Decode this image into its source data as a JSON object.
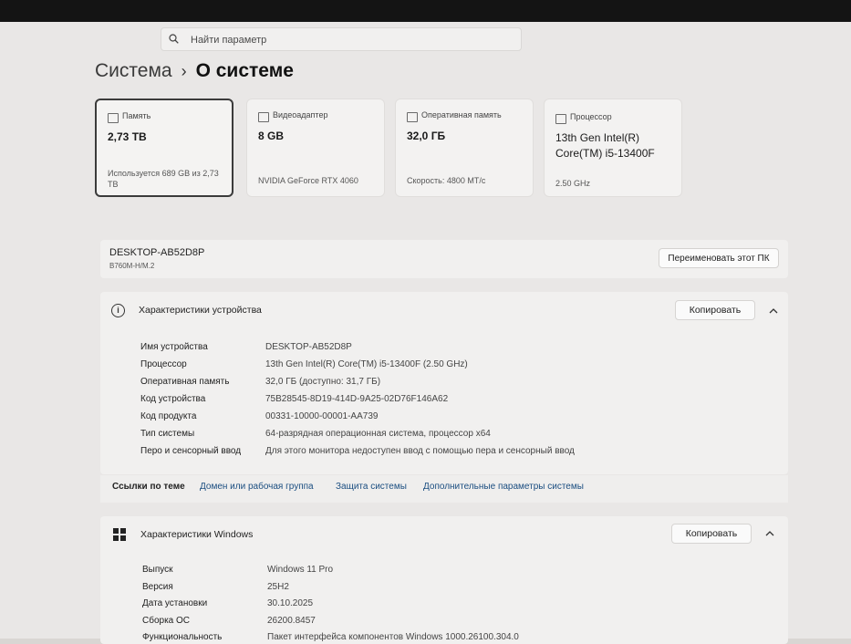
{
  "search": {
    "placeholder": "Найти параметр"
  },
  "breadcrumb": {
    "parent": "Система",
    "separator": "›",
    "current": "О системе"
  },
  "cards": [
    {
      "icon": "storage-icon",
      "label": "Память",
      "value": "2,73 TB",
      "detail": "Используется 689 GB из 2,73 TB"
    },
    {
      "icon": "gpu-icon",
      "label": "Видеоадаптер",
      "value": "8 GB",
      "detail": "NVIDIA GeForce RTX 4060"
    },
    {
      "icon": "ram-icon",
      "label": "Оперативная память",
      "value": "32,0 ГБ",
      "detail": "Скорость: 4800 MT/c"
    },
    {
      "icon": "cpu-icon",
      "label": "Процессор",
      "value": "13th Gen Intel(R) Core(TM) i5-13400F",
      "detail": "2.50 GHz"
    }
  ],
  "device": {
    "name": "DESKTOP-AB52D8P",
    "model": "B760M-H/M.2",
    "rename_label": "Переименовать этот ПК"
  },
  "device_specs": {
    "title": "Характеристики устройства",
    "copy_label": "Копировать",
    "rows": [
      {
        "label": "Имя устройства",
        "value": "DESKTOP-AB52D8P"
      },
      {
        "label": "Процессор",
        "value": "13th Gen Intel(R) Core(TM) i5-13400F (2.50 GHz)"
      },
      {
        "label": "Оперативная память",
        "value": "32,0 ГБ (доступно: 31,7 ГБ)"
      },
      {
        "label": "Код устройства",
        "value": "75B28545-8D19-414D-9A25-02D76F146A62"
      },
      {
        "label": "Код продукта",
        "value": "00331-10000-00001-AA739"
      },
      {
        "label": "Тип системы",
        "value": "64-разрядная операционная система, процессор x64"
      },
      {
        "label": "Перо и сенсорный ввод",
        "value": "Для этого монитора недоступен ввод с помощью пера и сенсорный ввод"
      }
    ]
  },
  "related_links": {
    "label": "Ссылки по теме",
    "links": [
      "Домен или рабочая группа",
      "Защита системы",
      "Дополнительные параметры системы"
    ]
  },
  "windows_specs": {
    "title": "Характеристики Windows",
    "copy_label": "Копировать",
    "rows": [
      {
        "label": "Выпуск",
        "value": "Windows 11 Pro"
      },
      {
        "label": "Версия",
        "value": "25H2"
      },
      {
        "label": "Дата установки",
        "value": "30.10.2025"
      },
      {
        "label": "Сборка ОС",
        "value": "26200.8457"
      },
      {
        "label": "Функциональность",
        "value": "Пакет интерфейса компонентов Windows 1000.26100.304.0"
      }
    ]
  }
}
